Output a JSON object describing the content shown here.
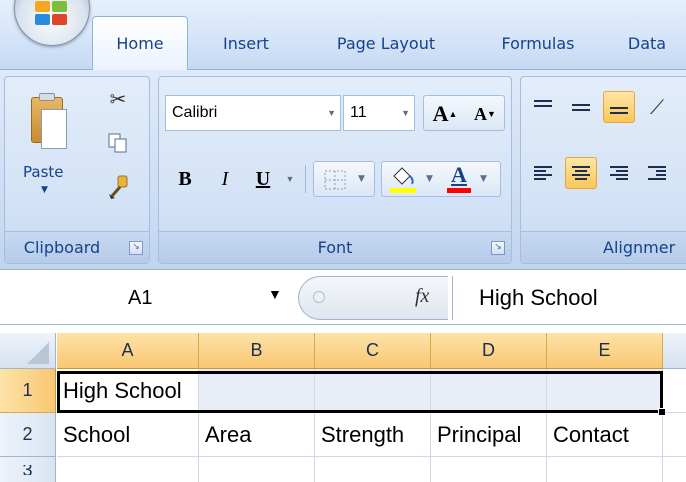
{
  "tabs": [
    "Home",
    "Insert",
    "Page Layout",
    "Formulas",
    "Data"
  ],
  "active_tab": "Home",
  "ribbon": {
    "clipboard": {
      "label": "Clipboard",
      "paste_label": "Paste"
    },
    "font": {
      "label": "Font",
      "font_name": "Calibri",
      "font_size": "11",
      "bold": "B",
      "italic": "I",
      "underline": "U",
      "grow_font": "A",
      "shrink_font": "A",
      "font_color_letter": "A",
      "highlight_color": "#ffff00",
      "font_color": "#ff0000"
    },
    "alignment": {
      "label": "Alignmer",
      "active_color": "#fbc657"
    }
  },
  "formula_bar": {
    "name_box": "A1",
    "fx_label": "fx",
    "formula": "High School"
  },
  "grid": {
    "columns": [
      "A",
      "B",
      "C",
      "D",
      "E"
    ],
    "rows": [
      {
        "number": "1",
        "cells": [
          "High School",
          "",
          "",
          "",
          ""
        ]
      },
      {
        "number": "2",
        "cells": [
          "School",
          "Area",
          "Strength",
          "Principal",
          "Contact"
        ]
      },
      {
        "number": "3",
        "cells": [
          "",
          "",
          "",
          "",
          ""
        ]
      }
    ]
  },
  "colors": {
    "accent": "#15428b",
    "header_selected": "#f9c773",
    "selection_border": "#000000"
  }
}
